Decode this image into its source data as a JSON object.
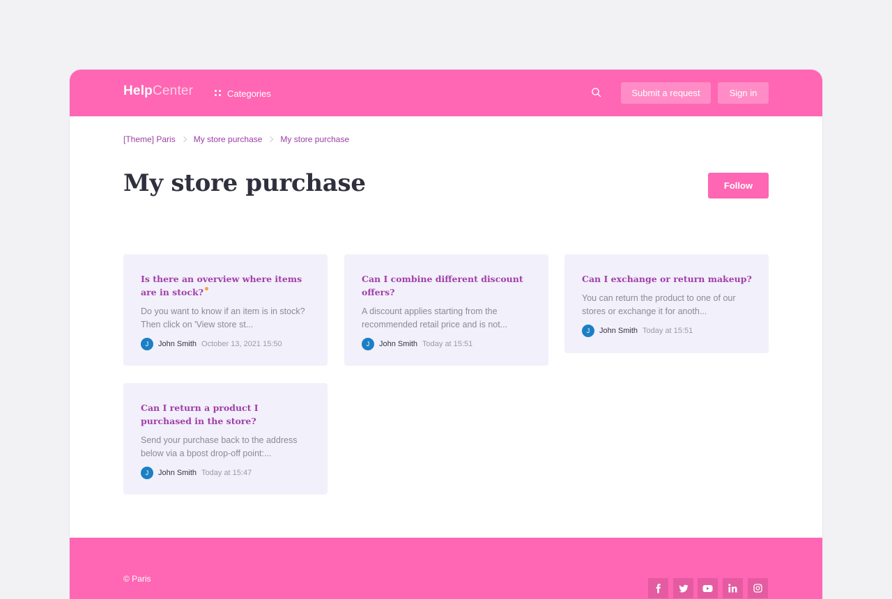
{
  "header": {
    "logo_bold": "Help",
    "logo_light": "Center",
    "categories_label": "Categories",
    "submit_label": "Submit a request",
    "signin_label": "Sign in"
  },
  "breadcrumb": [
    "[Theme] Paris",
    "My store purchase",
    "My store purchase"
  ],
  "page": {
    "title": "My store purchase",
    "follow_label": "Follow"
  },
  "articles": [
    {
      "title": "Is there an overview where items are in stock?",
      "excerpt": "Do you want to know if an item is in stock? Then click on 'View store st...",
      "avatar": "J",
      "author": "John Smith",
      "date": "October 13, 2021 15:50",
      "is_new": true
    },
    {
      "title": "Can I combine different discount offers?",
      "excerpt": "A discount applies starting from the recommended retail price and is not...",
      "avatar": "J",
      "author": "John Smith",
      "date": "Today at 15:51",
      "is_new": false
    },
    {
      "title": "Can I exchange or return makeup?",
      "excerpt": "You can return the product to one of our stores or exchange it for anoth...",
      "avatar": "J",
      "author": "John Smith",
      "date": "Today at 15:51",
      "is_new": false
    },
    {
      "title": "Can I return a product I purchased in the store?",
      "excerpt": "Send your purchase back to the address below via a bpost drop-off point:...",
      "avatar": "J",
      "author": "John Smith",
      "date": "Today at 15:47",
      "is_new": false
    }
  ],
  "footer": {
    "copyright": "© Paris",
    "social_icons": [
      "facebook-icon",
      "twitter-icon",
      "youtube-icon",
      "linkedin-icon",
      "instagram-icon"
    ]
  },
  "colors": {
    "brand_pink": "#ff66b3",
    "link_purple": "#9b3fa5",
    "card_bg": "#f2f0fb",
    "avatar_blue": "#1c7fc4",
    "new_dot": "#f7a13d"
  }
}
